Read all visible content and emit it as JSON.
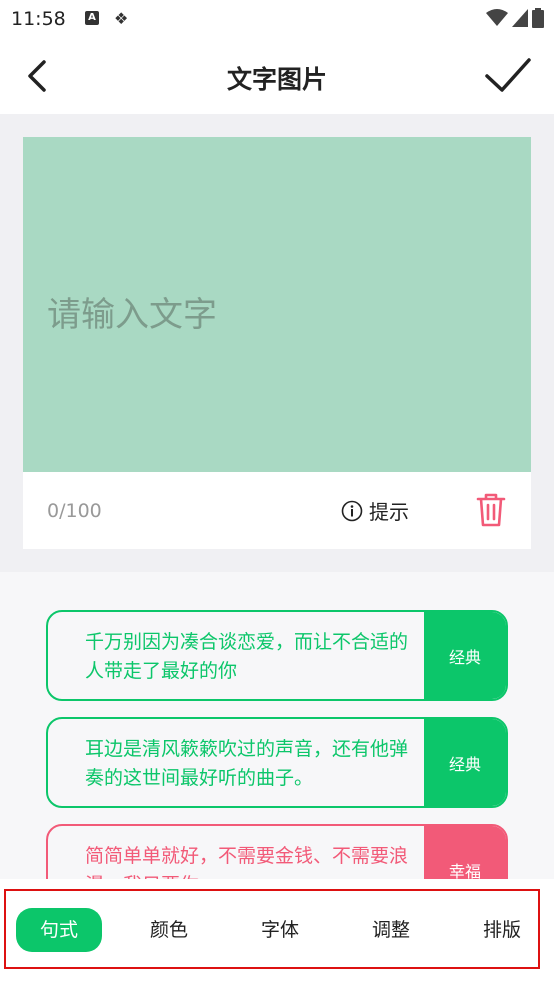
{
  "status_bar": {
    "time": "11:58",
    "badge": "A"
  },
  "header": {
    "title": "文字图片"
  },
  "editor": {
    "placeholder": "请输入文字",
    "char_count": "0/100",
    "hint_label": "提示",
    "canvas_color": "#a9d9c3"
  },
  "templates": [
    {
      "text": "千万别因为凑合谈恋爱，而让不合适的人带走了最好的你",
      "tag": "经典",
      "color": "#0cc66a"
    },
    {
      "text": "耳边是清风簌簌吹过的声音，还有他弹奏的这世间最好听的曲子。",
      "tag": "经典",
      "color": "#0cc66a"
    },
    {
      "text": "简简单单就好，不需要金钱、不需要浪漫，我只要你。",
      "tag": "幸福",
      "color": "#f25a78"
    }
  ],
  "tabs": [
    {
      "label": "句式",
      "active": true
    },
    {
      "label": "颜色",
      "active": false
    },
    {
      "label": "字体",
      "active": false
    },
    {
      "label": "调整",
      "active": false
    },
    {
      "label": "排版",
      "active": false
    }
  ],
  "colors": {
    "accent": "#0cc66a",
    "delete": "#f25a78",
    "highlight_frame": "#dd1111"
  }
}
